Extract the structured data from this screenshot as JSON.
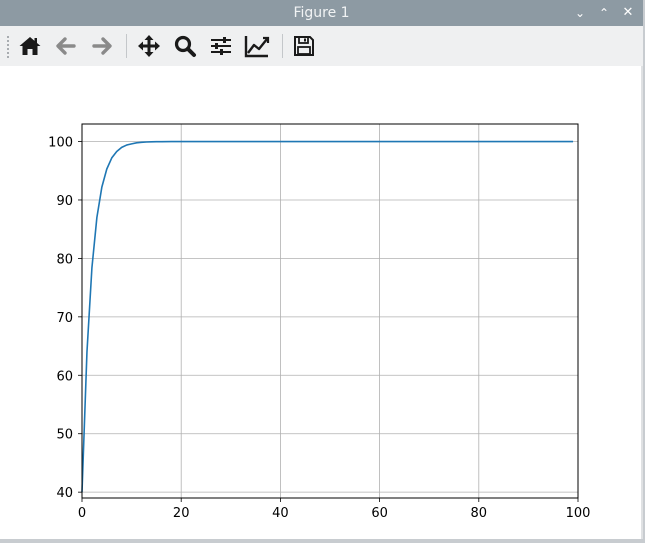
{
  "window": {
    "title": "Figure 1",
    "controls": {
      "minimize": "⌄",
      "maximize": "⌃",
      "close": "✕"
    }
  },
  "toolbar": {
    "buttons": [
      {
        "name": "home",
        "icon": "home-icon"
      },
      {
        "name": "back",
        "icon": "arrow-left-icon"
      },
      {
        "name": "forward",
        "icon": "arrow-right-icon"
      },
      {
        "name": "pan",
        "icon": "move-icon"
      },
      {
        "name": "zoom",
        "icon": "magnifier-icon"
      },
      {
        "name": "configure-subplots",
        "icon": "sliders-icon"
      },
      {
        "name": "edit-axes",
        "icon": "line-chart-icon"
      },
      {
        "name": "save",
        "icon": "floppy-disk-icon"
      }
    ]
  },
  "colors": {
    "titlebar": "#8d9aa3",
    "toolbar": "#eff0f1",
    "line": "#1f77b4",
    "grid": "#b0b0b0"
  },
  "chart_data": {
    "type": "line",
    "title": "",
    "xlabel": "",
    "ylabel": "",
    "xlim": [
      0,
      100
    ],
    "ylim": [
      39,
      103
    ],
    "grid": true,
    "xticks": [
      0,
      20,
      40,
      60,
      80,
      100
    ],
    "yticks": [
      40,
      50,
      60,
      70,
      80,
      90,
      100
    ],
    "series": [
      {
        "color": "#1f77b4",
        "x": [
          0,
          1,
          2,
          3,
          4,
          5,
          6,
          7,
          8,
          9,
          10,
          11,
          12,
          13,
          14,
          15,
          16,
          18,
          20,
          25,
          30,
          40,
          50,
          60,
          70,
          80,
          90,
          99
        ],
        "y": [
          40,
          64.0,
          78.4,
          87.0,
          92.2,
          95.3,
          97.2,
          98.3,
          99.0,
          99.4,
          99.6,
          99.78,
          99.87,
          99.92,
          99.95,
          99.97,
          99.98,
          99.99,
          100,
          100,
          100,
          100,
          100,
          100,
          100,
          100,
          100,
          100
        ]
      }
    ]
  }
}
